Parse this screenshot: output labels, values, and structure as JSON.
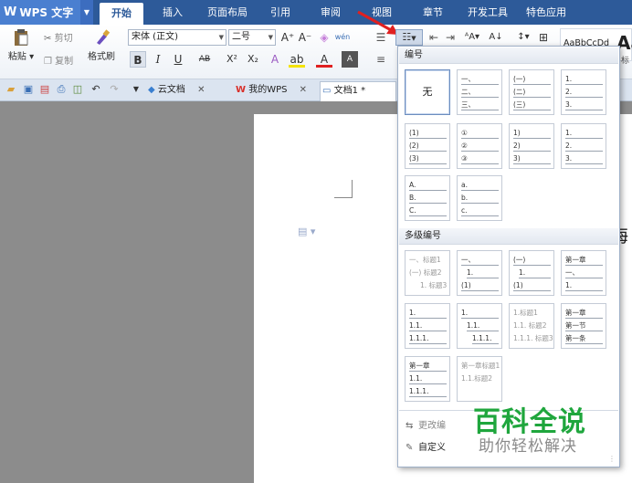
{
  "menubar": {
    "app_name": "WPS 文字",
    "tabs": [
      "开始",
      "插入",
      "页面布局",
      "引用",
      "审阅",
      "视图",
      "章节",
      "开发工具",
      "特色应用"
    ]
  },
  "ribbon": {
    "paste": "粘贴",
    "cut": "剪切",
    "copy": "复制",
    "format_painter": "格式刷",
    "font_name": "宋体 (正文)",
    "font_size": "二号",
    "bold": "B",
    "italic": "I",
    "underline": "U",
    "strikethrough": "AB",
    "superscript": "X²",
    "subscript": "X₂",
    "font_grow": "A⁺",
    "font_shrink": "A⁻",
    "phonetic": "wén",
    "style_sample_1": "AaBbCcDd",
    "style_sample_2": "Aa",
    "style_label": "标"
  },
  "docbar": {
    "tabs": [
      {
        "label": "云文档",
        "active": false
      },
      {
        "label": "我的WPS",
        "active": false
      },
      {
        "label": "文档1 *",
        "active": true
      }
    ]
  },
  "document": {
    "edge_char": "海"
  },
  "numbering_panel": {
    "section_numbering": "编号",
    "section_multilevel": "多级编号",
    "none_label": "无",
    "change_numbering": "更改编",
    "custom_numbering": "自定义",
    "single_level_cells": [
      [
        "无"
      ],
      [
        "一、",
        "二、",
        "三、"
      ],
      [
        "(一)",
        "(二)",
        "(三)"
      ],
      [
        "1.",
        "2.",
        "3."
      ],
      [
        "(1)",
        "(2)",
        "(3)"
      ],
      [
        "①",
        "②",
        "③"
      ],
      [
        "1)",
        "2)",
        "3)"
      ],
      [
        "1.",
        "2.",
        "3."
      ],
      [
        "A.",
        "B.",
        "C."
      ],
      [
        "a.",
        "b.",
        "c."
      ]
    ],
    "multilevel_cells": [
      [
        "一、标题1",
        "(一) 标题2",
        "1. 标题3"
      ],
      [
        "一、",
        "1.",
        "(1)"
      ],
      [
        "(一)",
        "1.",
        "(1)"
      ],
      [
        "第一章",
        "一、",
        "1."
      ],
      [
        "1.",
        "1.1.",
        "1.1.1."
      ],
      [
        "1.",
        "1.1.",
        "1.1.1."
      ],
      [
        "1.标题1",
        "1.1. 标题2",
        "1.1.1. 标题3"
      ],
      [
        "第一章",
        "第一节",
        "第一条"
      ],
      [
        "第一章",
        "1.1.",
        "1.1.1."
      ],
      [
        "第一章标题1",
        "1.1.标题2"
      ]
    ]
  },
  "watermark": {
    "main": "百科全说",
    "sub": "助你轻松解决"
  },
  "colors": {
    "menubar": "#2d5a99",
    "accent": "#4a7fd0",
    "annotation_arrow": "#e02020",
    "watermark_green": "#1fa63d"
  }
}
